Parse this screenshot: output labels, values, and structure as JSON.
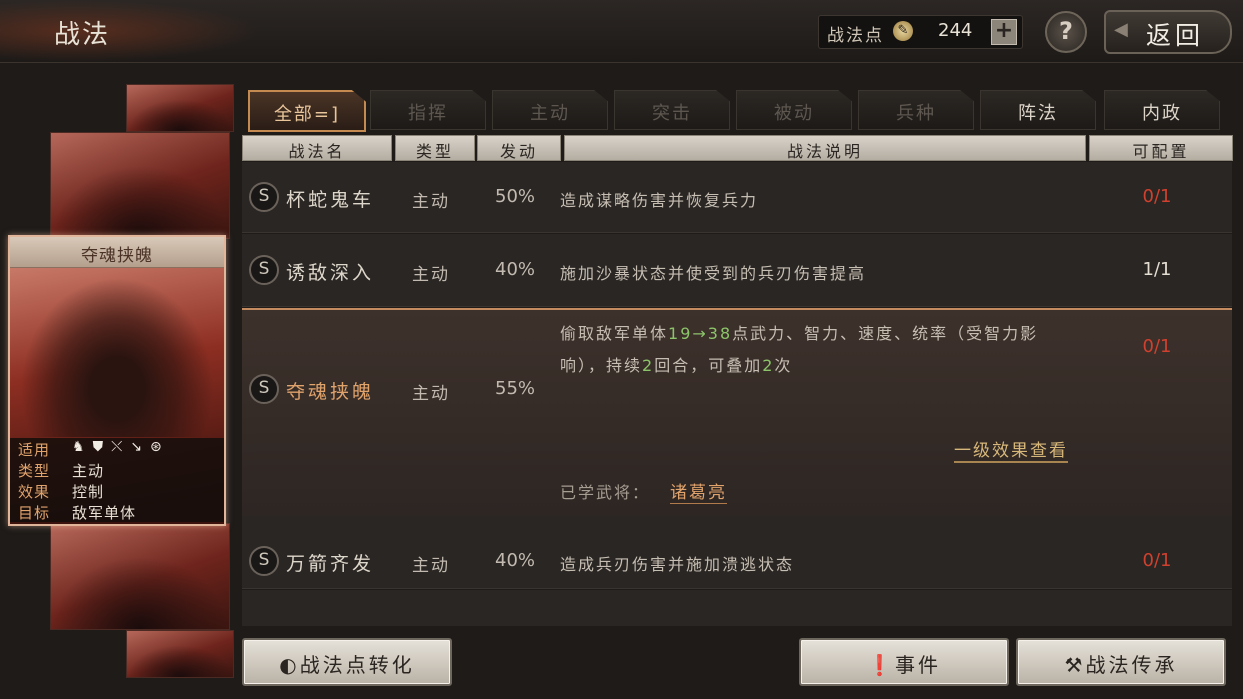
{
  "header": {
    "title": "战法",
    "points_label": "战法点",
    "points_value": "244",
    "plus_label": "+",
    "help_label": "?",
    "back_label": "返回"
  },
  "card": {
    "title": "夺魂挟魄",
    "rows": [
      {
        "key": "适用",
        "value": ""
      },
      {
        "key": "类型",
        "value": "主动"
      },
      {
        "key": "效果",
        "value": "控制"
      },
      {
        "key": "目标",
        "value": "敌军单体"
      }
    ],
    "unit_icons": [
      "cavalry-icon",
      "shield-icon",
      "bow-icon",
      "spear-icon",
      "wheel-icon"
    ]
  },
  "tabs": [
    {
      "label": "全部=]",
      "state": "active"
    },
    {
      "label": "指挥",
      "state": "disabled"
    },
    {
      "label": "主动",
      "state": "disabled"
    },
    {
      "label": "突击",
      "state": "disabled"
    },
    {
      "label": "被动",
      "state": "disabled"
    },
    {
      "label": "兵种",
      "state": "disabled"
    },
    {
      "label": "阵法",
      "state": "enabled"
    },
    {
      "label": "内政",
      "state": "enabled"
    }
  ],
  "columns": {
    "name": "战法名",
    "type": "类型",
    "trigger": "发动",
    "desc": "战法说明",
    "config": "可配置"
  },
  "skills": [
    {
      "grade": "S",
      "name": "杯蛇鬼车",
      "type": "主动",
      "rate": "50%",
      "desc": "造成谋略伤害并恢复兵力",
      "config": "0/1"
    },
    {
      "grade": "S",
      "name": "诱敌深入",
      "type": "主动",
      "rate": "40%",
      "desc": "施加沙暴状态并使受到的兵刃伤害提高",
      "config": "1/1"
    },
    {
      "grade": "S",
      "name": "夺魂挟魄",
      "type": "主动",
      "rate": "55%",
      "desc_parts": [
        "偷取敌军单体",
        "19",
        "→",
        "38",
        "点武力、智力、速度、统率（受智力影响），持续",
        "2",
        "回合，可叠加",
        "2",
        "次"
      ],
      "detail_link": "一级效果查看",
      "learned_label": "已学武将：",
      "learned_name": "诸葛亮",
      "config": "0/1"
    },
    {
      "grade": "S",
      "name": "万箭齐发",
      "type": "主动",
      "rate": "40%",
      "desc": "造成兵刃伤害并施加溃逃状态",
      "config": "0/1"
    }
  ],
  "footer": {
    "convert_label": "战法点转化",
    "event_label": "事件",
    "inherit_label": "战法传承"
  },
  "colors": {
    "accent": "#c48a60",
    "conf_full": "#e4ddd2",
    "conf_empty": "#d0402e",
    "highlight": "#8cc46a"
  }
}
